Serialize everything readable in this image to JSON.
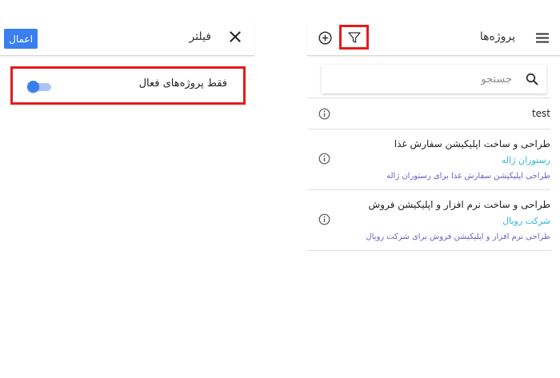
{
  "filter": {
    "title": "فیلتر",
    "apply_label": "اعمال",
    "active_only_label": "فقط پروژه‌های فعال",
    "active_only_enabled": true,
    "accent_color": "#3a7ff0",
    "highlight_color": "#e31b1b"
  },
  "projects": {
    "title": "پروژه‌ها",
    "search": {
      "placeholder": "جستجو",
      "value": ""
    },
    "items": [
      {
        "name": "test",
        "client": "",
        "description": ""
      },
      {
        "name": "طراحی و ساخت اپلیکیشن سفارش غذا",
        "client": "رستوران ژاله",
        "description": "طراحی اپلیکیشن سفارش غذا برای رستوران ژاله"
      },
      {
        "name": "طراحی و ساخت نرم افزار و اپلیکیشن فروش",
        "client": "شرکت رویال",
        "description": "طراحی نرم افزار و اپلیکیشن فروش برای شرکت رویال"
      }
    ],
    "client_color": "#2bb8d6",
    "description_color": "#6b5fc4"
  },
  "icons": {
    "close": "close-icon",
    "add": "plus-circle-icon",
    "filter": "filter-funnel-icon",
    "menu": "hamburger-menu-icon",
    "search": "search-icon",
    "info": "info-circle-icon"
  }
}
